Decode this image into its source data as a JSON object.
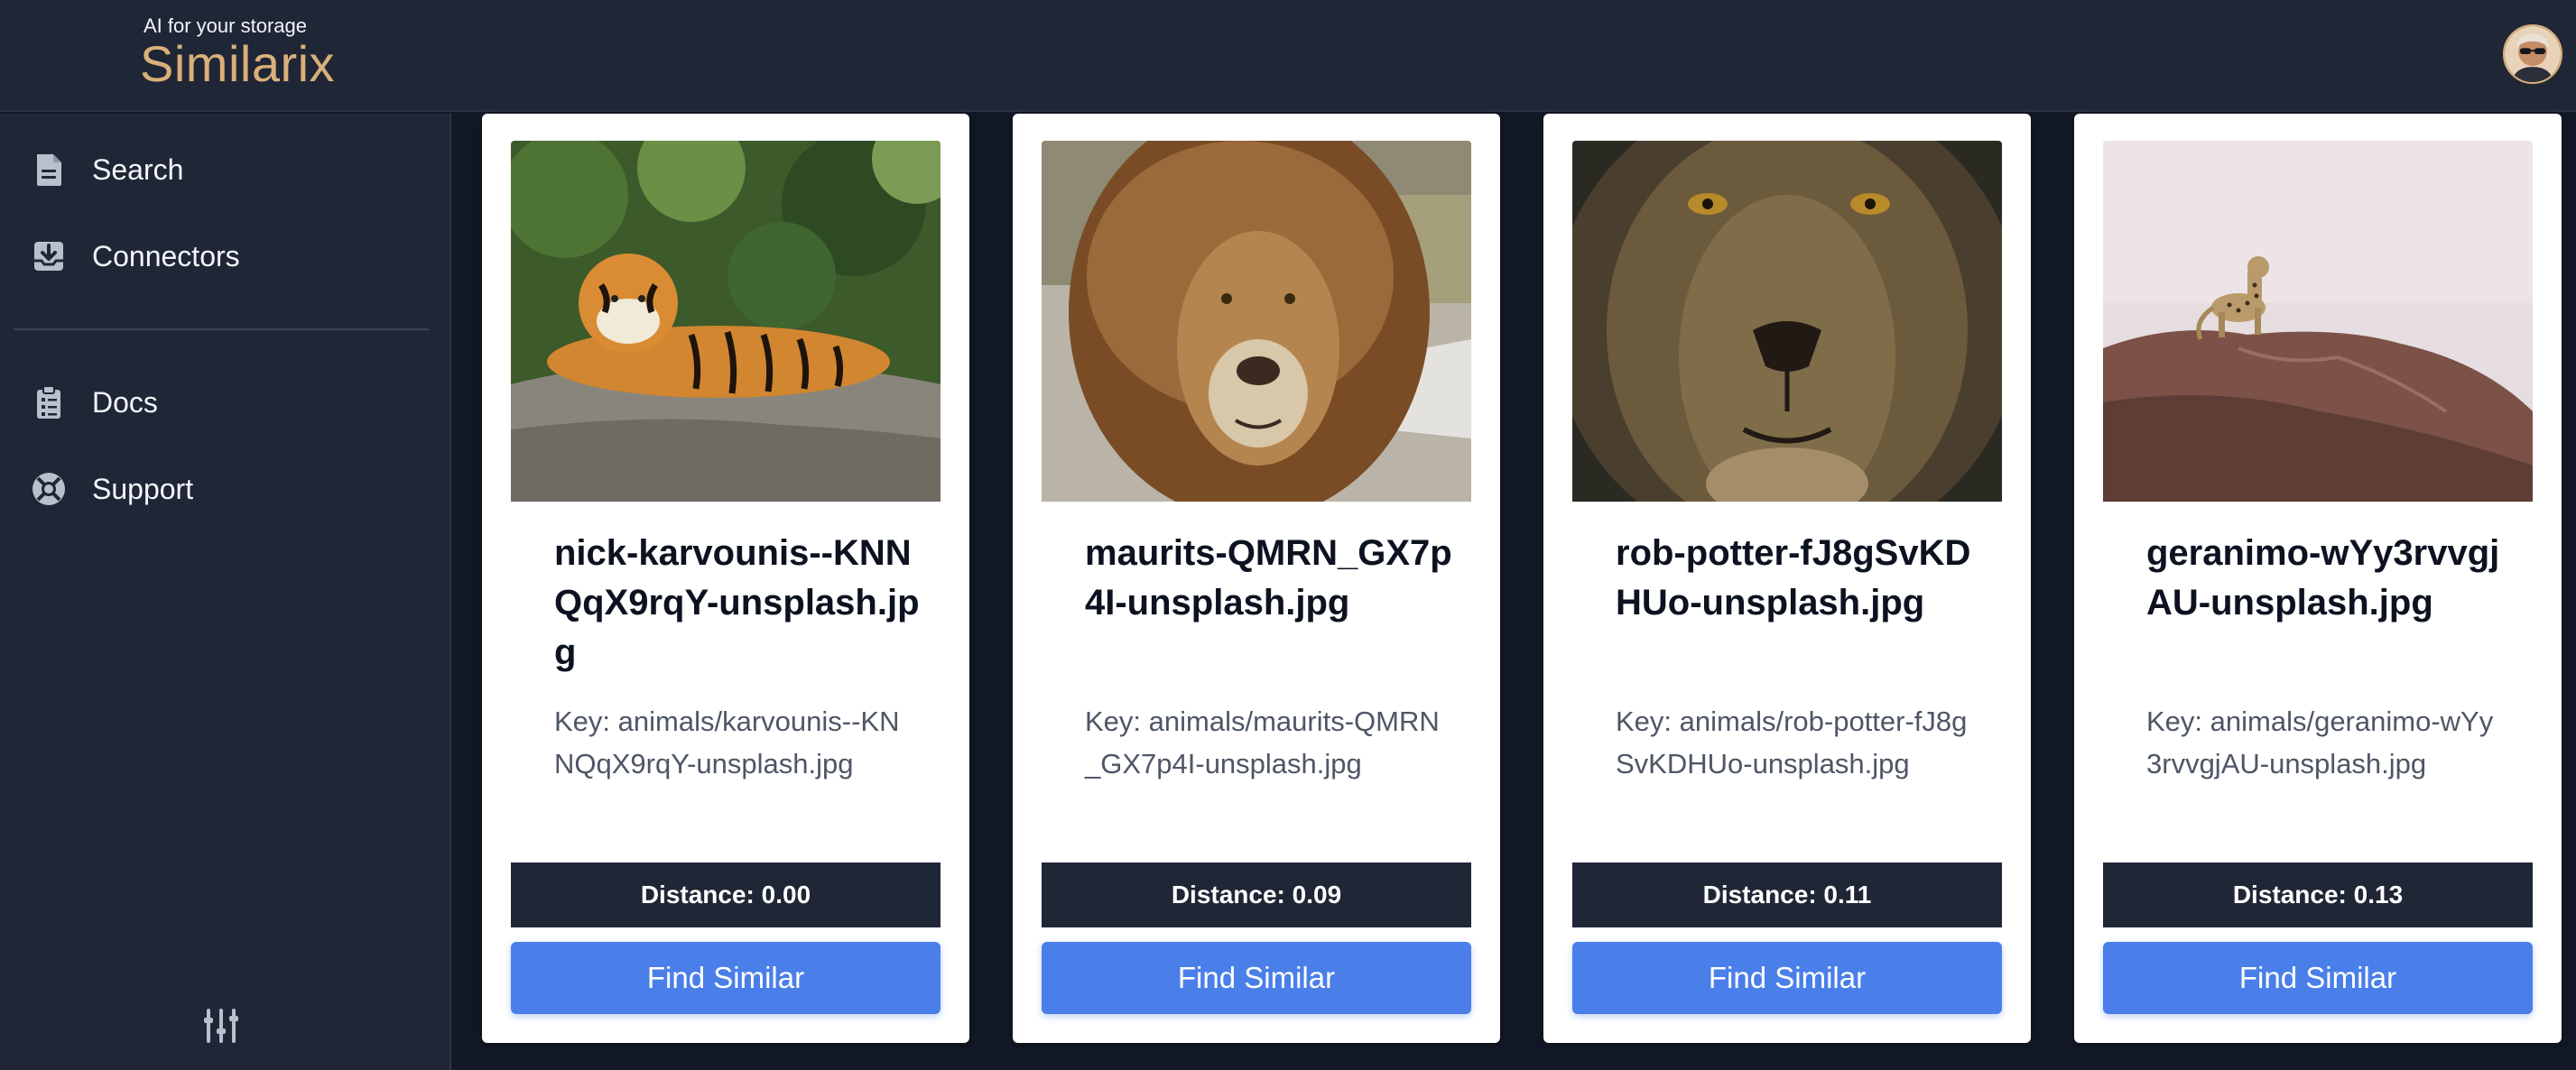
{
  "brand": {
    "tagline": "AI for your storage",
    "name": "Similarix",
    "accent_color": "#d9b079"
  },
  "user": {
    "avatar_icon": "user-avatar"
  },
  "sidebar": {
    "items": [
      {
        "label": "Search",
        "icon": "document-icon"
      },
      {
        "label": "Connectors",
        "icon": "inbox-download-icon"
      },
      {
        "label": "Docs",
        "icon": "clipboard-icon"
      },
      {
        "label": "Support",
        "icon": "lifebuoy-icon"
      }
    ],
    "footer_icon": "sliders-icon"
  },
  "colors": {
    "background": "#121826",
    "panel": "#1f2636",
    "button": "#4a7fe9"
  },
  "results": [
    {
      "title": "nick-karvounis--KNNQqX9rqY-unsplash.jpg",
      "key": "Key: animals/karvounis--KNNQqX9rqY-unsplash.jpg",
      "distance": "Distance: 0.00",
      "button": "Find Similar",
      "image": "tiger-on-rock"
    },
    {
      "title": "maurits-QMRN_GX7p4I-unsplash.jpg",
      "key": "Key: animals/maurits-QMRN_GX7p4I-unsplash.jpg",
      "distance": "Distance: 0.09",
      "button": "Find Similar",
      "image": "maned-lion"
    },
    {
      "title": "rob-potter-fJ8gSvKDHUo-unsplash.jpg",
      "key": "Key: animals/rob-potter-fJ8gSvKDHUo-unsplash.jpg",
      "distance": "Distance: 0.11",
      "button": "Find Similar",
      "image": "lion-face-closeup"
    },
    {
      "title": "geranimo-wYy3rvvgjAU-unsplash.jpg",
      "key": "Key: animals/geranimo-wYy3rvvgjAU-unsplash.jpg",
      "distance": "Distance: 0.13",
      "button": "Find Similar",
      "image": "leopard-on-rock"
    }
  ]
}
